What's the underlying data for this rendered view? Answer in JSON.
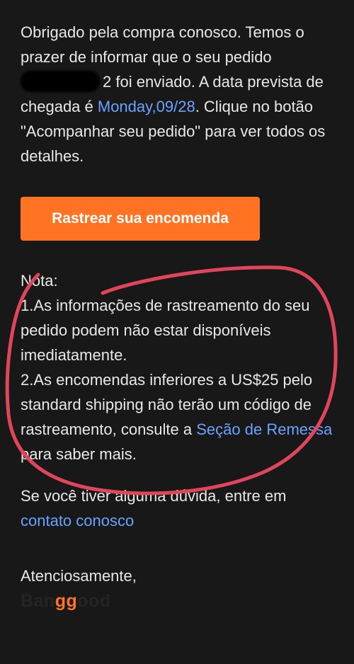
{
  "email": {
    "intro_before_redaction": "Obrigado pela compra conosco. Temos o prazer de informar que o seu pedido ",
    "order_number_suffix": "2",
    "intro_after_redaction": " foi enviado. A data prevista de chegada é ",
    "arrival_date": "Monday,09/28",
    "intro_end": ". Clique no botão \"Acompanhar seu pedido\" para ver todos os detalhes.",
    "track_button_label": "Rastrear sua encomenda",
    "note_title": "Nota:",
    "note_item_1": "1.As informações de rastreamento do seu pedido podem não estar disponíveis imediatamente.",
    "note_item_2_before_link": "2.As encomendas inferiores a US$25 pelo standard shipping não terão um código de rastreamento, consulte a ",
    "shipping_section_link": "Seção de Remessa",
    "note_item_2_after_link": " para saber mais.",
    "question_text": "Se você tiver alguma dúvida, entre em",
    "contact_link": "contato conosco",
    "signoff": "Atenciosamente,",
    "brand_prefix": "Ban",
    "brand_highlight": "gg",
    "brand_suffix": "ood"
  },
  "colors": {
    "background": "#181818",
    "text": "#e8e8e8",
    "link": "#6aa2ff",
    "button": "#ff7322",
    "annotation": "#e0455b"
  }
}
